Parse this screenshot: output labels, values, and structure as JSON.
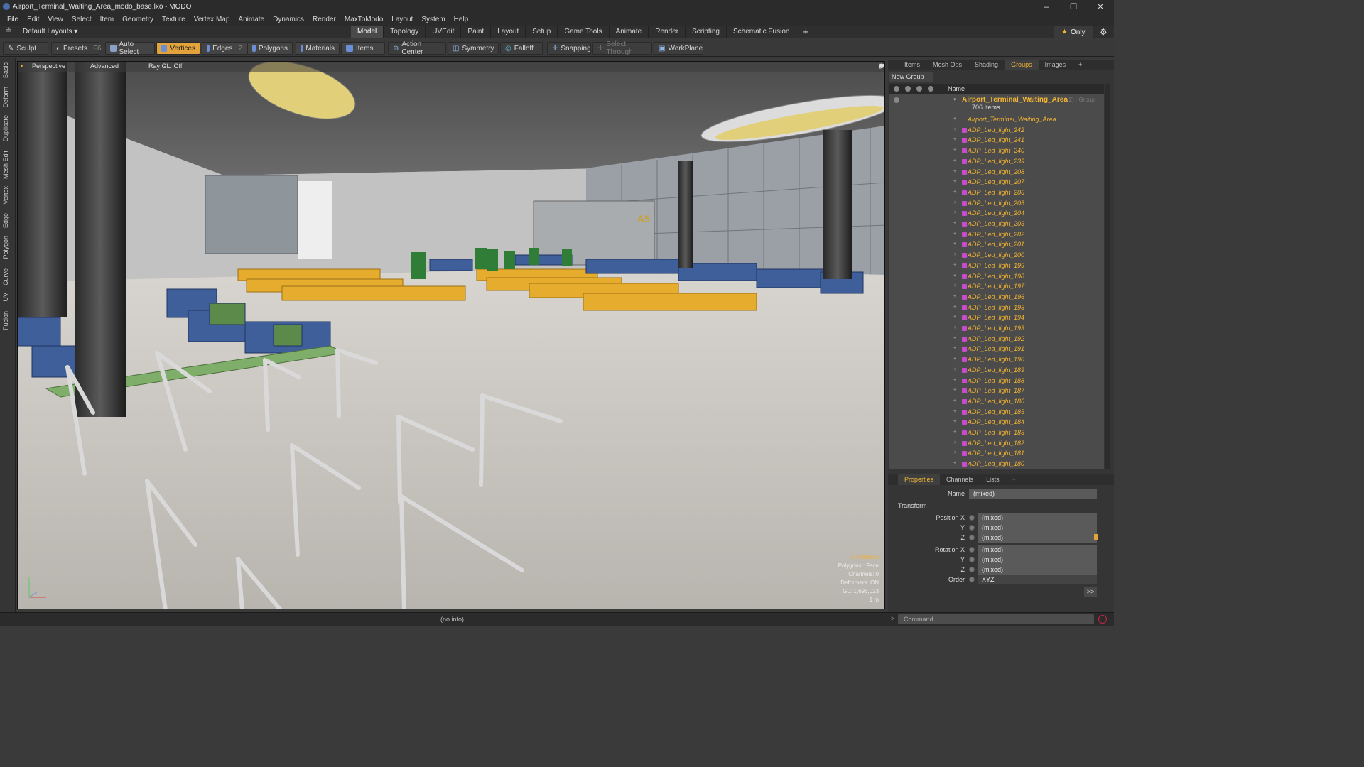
{
  "window": {
    "title": "Airport_Terminal_Waiting_Area_modo_base.lxo - MODO",
    "controls": [
      "–",
      "❐",
      "✕"
    ]
  },
  "menu": [
    "File",
    "Edit",
    "View",
    "Select",
    "Item",
    "Geometry",
    "Texture",
    "Vertex Map",
    "Animate",
    "Dynamics",
    "Render",
    "MaxToModo",
    "Layout",
    "System",
    "Help"
  ],
  "layoutbar": {
    "layout_label": "Default Layouts ▾",
    "tabs": [
      "Model",
      "Topology",
      "UVEdit",
      "Paint",
      "Layout",
      "Setup",
      "Game Tools",
      "Animate",
      "Render",
      "Scripting",
      "Schematic Fusion"
    ],
    "active_tab": "Model",
    "only_label": "Only"
  },
  "toolbar": {
    "sculpt": "Sculpt",
    "presets": "Presets",
    "presets_key": "F6",
    "auto_select": "Auto Select",
    "vertices": "Vertices",
    "edges": "Edges",
    "edges_num": "2",
    "polygons": "Polygons",
    "materials": "Materials",
    "items": "Items",
    "action_center": "Action Center",
    "symmetry": "Symmetry",
    "falloff": "Falloff",
    "snapping": "Snapping",
    "select_through": "Select Through",
    "workplane": "WorkPlane"
  },
  "left_tabs": [
    "Basic",
    "Deform",
    "Duplicate",
    "Mesh Edit",
    "Vertex",
    "Edge",
    "Polygon",
    "Curve",
    "UV",
    "Fusion"
  ],
  "viewport": {
    "view": "Perspective",
    "shading": "Advanced",
    "raygl": "Ray GL: Off",
    "info": [
      "All Vertices",
      "Polygons : Face",
      "Channels: 0",
      "Deformers: ON",
      "GL: 1,696,023",
      "1 m"
    ]
  },
  "panel_tabs": [
    "Items",
    "Mesh Ops",
    "Shading",
    "Groups",
    "Images"
  ],
  "active_panel_tab": "Groups",
  "groups": {
    "new_group": "New Group",
    "column_name": "Name",
    "root": {
      "name": "Airport_Terminal_Waiting_Area",
      "suffix": "(2) : Group",
      "count": "706 Items"
    },
    "items": [
      "Airport_Terminal_Waiting_Area",
      "ADP_Led_light_242",
      "ADP_Led_light_241",
      "ADP_Led_light_240",
      "ADP_Led_light_239",
      "ADP_Led_light_208",
      "ADP_Led_light_207",
      "ADP_Led_light_206",
      "ADP_Led_light_205",
      "ADP_Led_light_204",
      "ADP_Led_light_203",
      "ADP_Led_light_202",
      "ADP_Led_light_201",
      "ADP_Led_light_200",
      "ADP_Led_light_199",
      "ADP_Led_light_198",
      "ADP_Led_light_197",
      "ADP_Led_light_196",
      "ADP_Led_light_195",
      "ADP_Led_light_194",
      "ADP_Led_light_193",
      "ADP_Led_light_192",
      "ADP_Led_light_191",
      "ADP_Led_light_190",
      "ADP_Led_light_189",
      "ADP_Led_light_188",
      "ADP_Led_light_187",
      "ADP_Led_light_186",
      "ADP_Led_light_185",
      "ADP_Led_light_184",
      "ADP_Led_light_183",
      "ADP_Led_light_182",
      "ADP_Led_light_181",
      "ADP_Led_light_180"
    ]
  },
  "props_tabs": [
    "Properties",
    "Channels",
    "Lists"
  ],
  "properties": {
    "name_label": "Name",
    "name_value": "(mixed)",
    "transform_label": "Transform",
    "position_x_label": "Position X",
    "y_label": "Y",
    "z_label": "Z",
    "rotation_x_label": "Rotation X",
    "order_label": "Order",
    "mixed": "(mixed)",
    "order_value": "XYZ"
  },
  "statusbar": {
    "info": "(no info)",
    "command_placeholder": "Command"
  },
  "colors": {
    "accent": "#f3b432",
    "active_button": "#e3a33b",
    "group_icon": "#c74ccc"
  }
}
